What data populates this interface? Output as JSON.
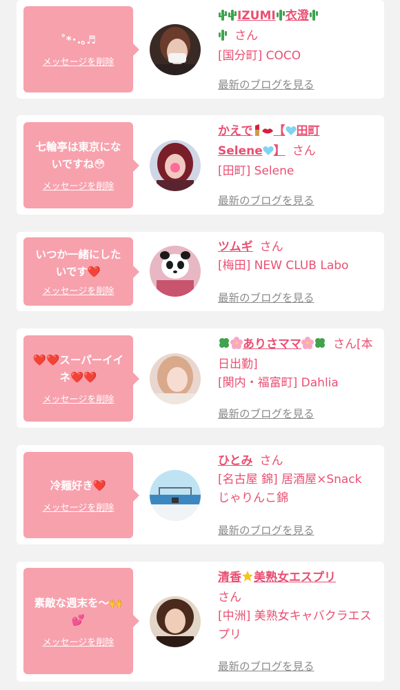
{
  "colors": {
    "accent": "#e94f72",
    "bubble": "#f7a1ad",
    "blog_link": "#8a8a8a",
    "background": "#f2f2f2"
  },
  "delete_label": "メッセージを削除",
  "san_label": "さん",
  "blog_label": "最新のブログを見る",
  "items": [
    {
      "message": "˚*･.｡♬",
      "name": "IZUMI衣澄",
      "name_icons": [
        "cactus-icon"
      ],
      "extra": "",
      "shop": "[国分町] COCO"
    },
    {
      "message": "七輪亭は東京にないですね😳",
      "name": "かえで【田町Selene】",
      "name_icons": [
        "lipstick-icon",
        "kiss-lips-icon",
        "light-blue-heart-icon"
      ],
      "extra": "",
      "shop": "[田町] Selene"
    },
    {
      "message": "いつか一緒にしたいです❤️",
      "name": "ツムギ",
      "name_icons": [],
      "extra": "",
      "shop": "[梅田] NEW CLUB Labo"
    },
    {
      "message": "❤️❤️スーパーイイネ❤️❤️",
      "name": "ありさママ",
      "name_icons": [
        "four-leaf-clover-icon",
        "cherry-blossom-icon"
      ],
      "extra": "[本日出勤]",
      "shop": "[関内・福富町] Dahlia"
    },
    {
      "message": "冷麺好き❤️",
      "name": "ひとみ",
      "name_icons": [],
      "extra": "",
      "shop": "[名古屋 錦] 居酒屋×Snack じゃりんこ錦"
    },
    {
      "message": "素敵な週末を〜🙌💕",
      "name": "清香美熟女エスプリ",
      "name_icons": [
        "star-icon"
      ],
      "extra": "",
      "shop": "[中洲] 美熟女キャバクラエスプリ"
    }
  ]
}
